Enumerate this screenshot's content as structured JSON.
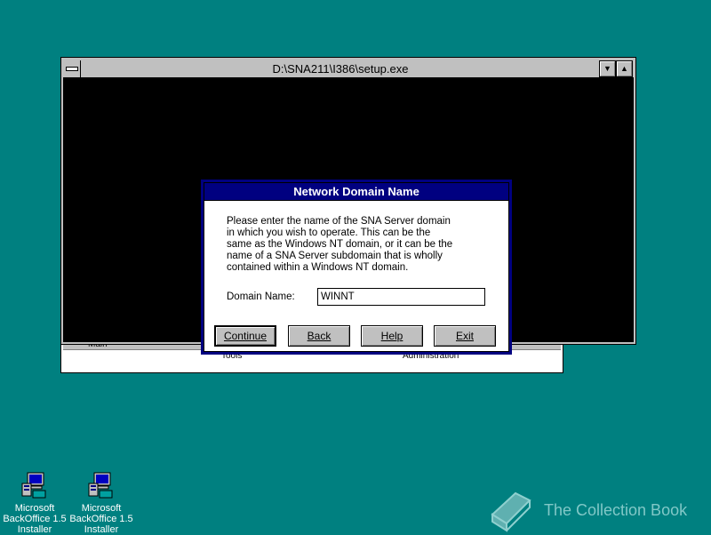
{
  "console": {
    "title": "D:\\SNA211\\I386\\setup.exe",
    "controls": [
      "minimize-arrow",
      "maximize-arrow"
    ]
  },
  "background_window": {
    "tab": "Main",
    "labels": [
      "Tools",
      "Administration"
    ]
  },
  "dialog": {
    "title": "Network Domain Name",
    "message": "Please enter the name of the SNA Server domain\nin which you wish to operate.  This can be the\nsame as the Windows NT domain, or it can be the\nname of a SNA Server subdomain that is wholly\ncontained within a Windows NT domain.",
    "domain_label": "Domain Name:",
    "domain_value": "WINNT",
    "buttons": {
      "continue": "Continue",
      "back": "Back",
      "help": "Help",
      "exit": "Exit"
    }
  },
  "desktop_icons": [
    {
      "label": "Microsoft\nBackOffice 1.5\nInstaller"
    },
    {
      "label": "Microsoft\nBackOffice 1.5\nInstaller"
    }
  ],
  "watermark": {
    "text": "The Collection Book"
  },
  "colors": {
    "desktop": "#008080",
    "title_active": "#000080",
    "face": "#c0c0c0"
  }
}
